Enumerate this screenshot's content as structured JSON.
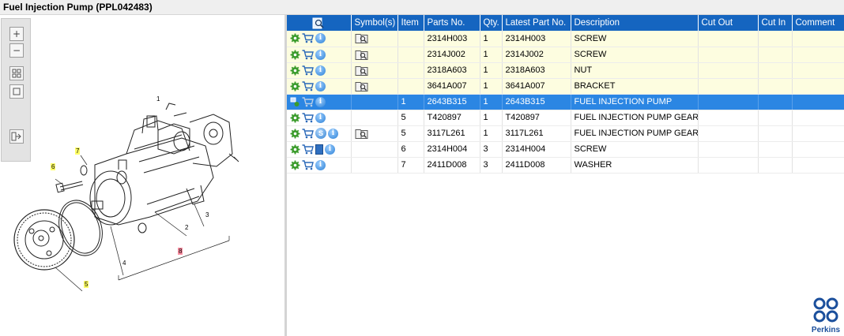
{
  "window": {
    "title": "Fuel Injection Pump (PPL042483)"
  },
  "toolbar": {
    "buttons": [
      {
        "icon": "zoom-in-icon"
      },
      {
        "icon": "zoom-out-icon"
      },
      {
        "icon": "fit-all-icon"
      },
      {
        "icon": "fit-page-icon"
      },
      {
        "icon": "export-icon"
      }
    ]
  },
  "diagram": {
    "callouts": [
      "7",
      "6",
      "1",
      "2",
      "3",
      "4",
      "5",
      "8"
    ]
  },
  "table": {
    "headers": {
      "view": "",
      "symbols": "Symbol(s)",
      "item": "Item",
      "parts_no": "Parts No.",
      "qty": "Qty.",
      "latest_part_no": "Latest Part No.",
      "description": "Description",
      "cut_out": "Cut Out",
      "cut_in": "Cut In",
      "comment": "Comment"
    },
    "rows": [
      {
        "item": "",
        "parts_no": "2314H003",
        "qty": "1",
        "latest_part_no": "2314H003",
        "description": "SCREW",
        "cut_out": "",
        "cut_in": "",
        "comment": ""
      },
      {
        "item": "",
        "parts_no": "2314J002",
        "qty": "1",
        "latest_part_no": "2314J002",
        "description": "SCREW",
        "cut_out": "",
        "cut_in": "",
        "comment": ""
      },
      {
        "item": "",
        "parts_no": "2318A603",
        "qty": "1",
        "latest_part_no": "2318A603",
        "description": "NUT",
        "cut_out": "",
        "cut_in": "",
        "comment": ""
      },
      {
        "item": "",
        "parts_no": "3641A007",
        "qty": "1",
        "latest_part_no": "3641A007",
        "description": "BRACKET",
        "cut_out": "",
        "cut_in": "",
        "comment": ""
      },
      {
        "item": "1",
        "parts_no": "2643B315",
        "qty": "1",
        "latest_part_no": "2643B315",
        "description": "FUEL INJECTION PUMP",
        "cut_out": "",
        "cut_in": "",
        "comment": ""
      },
      {
        "item": "5",
        "parts_no": "T420897",
        "qty": "1",
        "latest_part_no": "T420897",
        "description": "FUEL INJECTION PUMP GEAR",
        "cut_out": "",
        "cut_in": "",
        "comment": ""
      },
      {
        "item": "5",
        "parts_no": "3117L261",
        "qty": "1",
        "latest_part_no": "3117L261",
        "description": "FUEL INJECTION PUMP GEAR",
        "cut_out": "",
        "cut_in": "",
        "comment": ""
      },
      {
        "item": "6",
        "parts_no": "2314H004",
        "qty": "3",
        "latest_part_no": "2314H004",
        "description": "SCREW",
        "cut_out": "",
        "cut_in": "",
        "comment": ""
      },
      {
        "item": "7",
        "parts_no": "2411D008",
        "qty": "3",
        "latest_part_no": "2411D008",
        "description": "WASHER",
        "cut_out": "",
        "cut_in": "",
        "comment": ""
      }
    ]
  },
  "icons": {
    "s_badge": "S",
    "info": "i"
  },
  "brand": {
    "name": "Perkins",
    "color": "#1b4f9c"
  },
  "colors": {
    "header": "#1565c0",
    "selected_row": "#2b86e3",
    "highlight_row": "#fdfde0"
  }
}
